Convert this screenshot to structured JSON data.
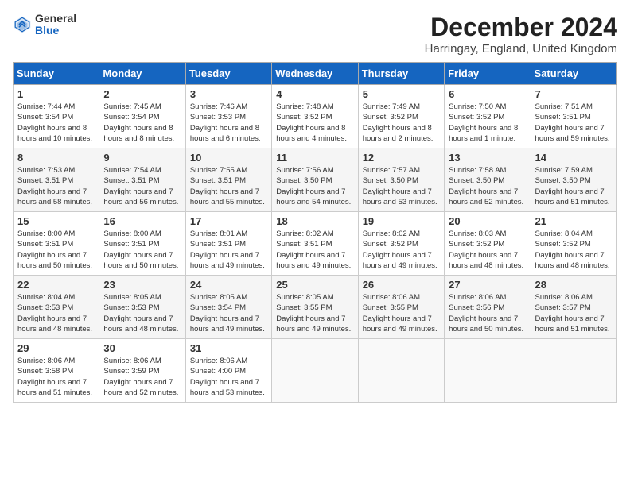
{
  "header": {
    "logo_general": "General",
    "logo_blue": "Blue",
    "main_title": "December 2024",
    "subtitle": "Harringay, England, United Kingdom"
  },
  "columns": [
    "Sunday",
    "Monday",
    "Tuesday",
    "Wednesday",
    "Thursday",
    "Friday",
    "Saturday"
  ],
  "weeks": [
    {
      "days": [
        {
          "num": "1",
          "sunrise": "7:44 AM",
          "sunset": "3:54 PM",
          "daylight": "8 hours and 10 minutes."
        },
        {
          "num": "2",
          "sunrise": "7:45 AM",
          "sunset": "3:54 PM",
          "daylight": "8 hours and 8 minutes."
        },
        {
          "num": "3",
          "sunrise": "7:46 AM",
          "sunset": "3:53 PM",
          "daylight": "8 hours and 6 minutes."
        },
        {
          "num": "4",
          "sunrise": "7:48 AM",
          "sunset": "3:52 PM",
          "daylight": "8 hours and 4 minutes."
        },
        {
          "num": "5",
          "sunrise": "7:49 AM",
          "sunset": "3:52 PM",
          "daylight": "8 hours and 2 minutes."
        },
        {
          "num": "6",
          "sunrise": "7:50 AM",
          "sunset": "3:52 PM",
          "daylight": "8 hours and 1 minute."
        },
        {
          "num": "7",
          "sunrise": "7:51 AM",
          "sunset": "3:51 PM",
          "daylight": "7 hours and 59 minutes."
        }
      ]
    },
    {
      "days": [
        {
          "num": "8",
          "sunrise": "7:53 AM",
          "sunset": "3:51 PM",
          "daylight": "7 hours and 58 minutes."
        },
        {
          "num": "9",
          "sunrise": "7:54 AM",
          "sunset": "3:51 PM",
          "daylight": "7 hours and 56 minutes."
        },
        {
          "num": "10",
          "sunrise": "7:55 AM",
          "sunset": "3:51 PM",
          "daylight": "7 hours and 55 minutes."
        },
        {
          "num": "11",
          "sunrise": "7:56 AM",
          "sunset": "3:50 PM",
          "daylight": "7 hours and 54 minutes."
        },
        {
          "num": "12",
          "sunrise": "7:57 AM",
          "sunset": "3:50 PM",
          "daylight": "7 hours and 53 minutes."
        },
        {
          "num": "13",
          "sunrise": "7:58 AM",
          "sunset": "3:50 PM",
          "daylight": "7 hours and 52 minutes."
        },
        {
          "num": "14",
          "sunrise": "7:59 AM",
          "sunset": "3:50 PM",
          "daylight": "7 hours and 51 minutes."
        }
      ]
    },
    {
      "days": [
        {
          "num": "15",
          "sunrise": "8:00 AM",
          "sunset": "3:51 PM",
          "daylight": "7 hours and 50 minutes."
        },
        {
          "num": "16",
          "sunrise": "8:00 AM",
          "sunset": "3:51 PM",
          "daylight": "7 hours and 50 minutes."
        },
        {
          "num": "17",
          "sunrise": "8:01 AM",
          "sunset": "3:51 PM",
          "daylight": "7 hours and 49 minutes."
        },
        {
          "num": "18",
          "sunrise": "8:02 AM",
          "sunset": "3:51 PM",
          "daylight": "7 hours and 49 minutes."
        },
        {
          "num": "19",
          "sunrise": "8:02 AM",
          "sunset": "3:52 PM",
          "daylight": "7 hours and 49 minutes."
        },
        {
          "num": "20",
          "sunrise": "8:03 AM",
          "sunset": "3:52 PM",
          "daylight": "7 hours and 48 minutes."
        },
        {
          "num": "21",
          "sunrise": "8:04 AM",
          "sunset": "3:52 PM",
          "daylight": "7 hours and 48 minutes."
        }
      ]
    },
    {
      "days": [
        {
          "num": "22",
          "sunrise": "8:04 AM",
          "sunset": "3:53 PM",
          "daylight": "7 hours and 48 minutes."
        },
        {
          "num": "23",
          "sunrise": "8:05 AM",
          "sunset": "3:53 PM",
          "daylight": "7 hours and 48 minutes."
        },
        {
          "num": "24",
          "sunrise": "8:05 AM",
          "sunset": "3:54 PM",
          "daylight": "7 hours and 49 minutes."
        },
        {
          "num": "25",
          "sunrise": "8:05 AM",
          "sunset": "3:55 PM",
          "daylight": "7 hours and 49 minutes."
        },
        {
          "num": "26",
          "sunrise": "8:06 AM",
          "sunset": "3:55 PM",
          "daylight": "7 hours and 49 minutes."
        },
        {
          "num": "27",
          "sunrise": "8:06 AM",
          "sunset": "3:56 PM",
          "daylight": "7 hours and 50 minutes."
        },
        {
          "num": "28",
          "sunrise": "8:06 AM",
          "sunset": "3:57 PM",
          "daylight": "7 hours and 51 minutes."
        }
      ]
    },
    {
      "days": [
        {
          "num": "29",
          "sunrise": "8:06 AM",
          "sunset": "3:58 PM",
          "daylight": "7 hours and 51 minutes."
        },
        {
          "num": "30",
          "sunrise": "8:06 AM",
          "sunset": "3:59 PM",
          "daylight": "7 hours and 52 minutes."
        },
        {
          "num": "31",
          "sunrise": "8:06 AM",
          "sunset": "4:00 PM",
          "daylight": "7 hours and 53 minutes."
        },
        null,
        null,
        null,
        null
      ]
    }
  ]
}
